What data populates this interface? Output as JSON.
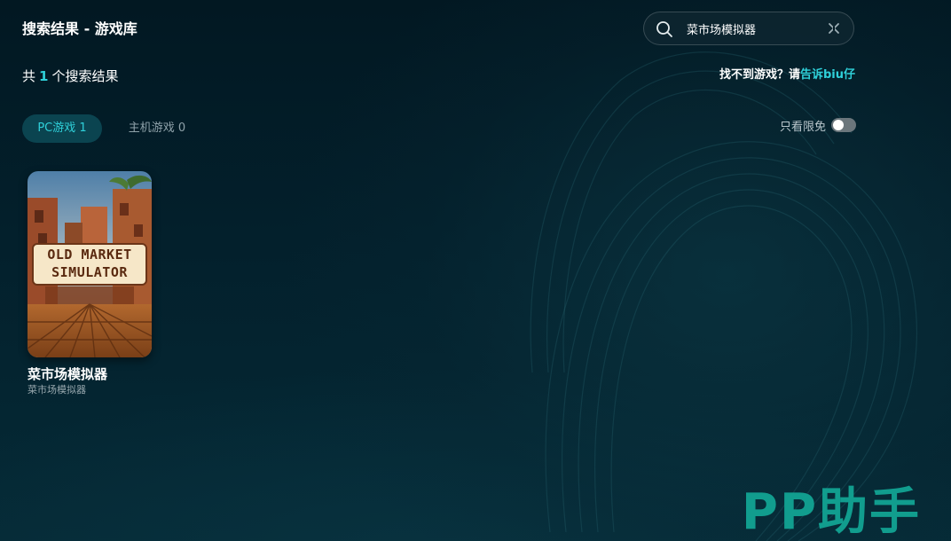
{
  "header": {
    "title": "搜索结果 - 游戏库"
  },
  "search": {
    "value": "菜市场模拟器",
    "icon": "search-icon",
    "clear_icon": "close-icon"
  },
  "results": {
    "prefix": "共",
    "count": "1",
    "suffix": "个搜索结果"
  },
  "feedback": {
    "text": "找不到游戏？请",
    "link": "告诉biu仔"
  },
  "tabs": [
    {
      "label": "PC游戏 1",
      "active": true
    },
    {
      "label": "主机游戏 0",
      "active": false
    }
  ],
  "filter": {
    "label": "只看限免",
    "enabled": false
  },
  "games": [
    {
      "cover_text_line1": "OLD MARKET",
      "cover_text_line2": "SIMULATOR",
      "title": "菜市场模拟器",
      "subtitle": "菜市场模拟器"
    }
  ],
  "watermark": "PP助手",
  "colors": {
    "accent": "#2fd0d9",
    "tab_active_bg": "#0b4450",
    "watermark": "#12a493"
  }
}
